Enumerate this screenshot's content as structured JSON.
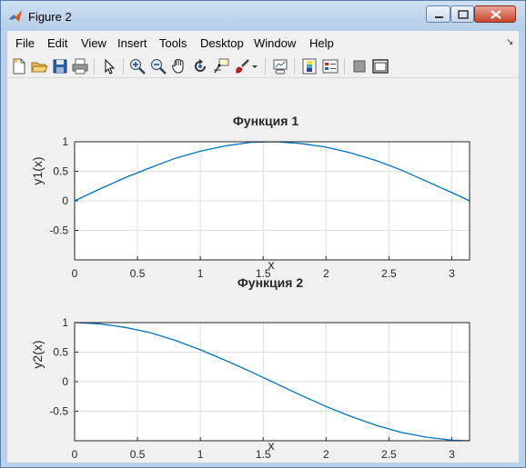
{
  "window": {
    "title": "Figure 2"
  },
  "menu": [
    "File",
    "Edit",
    "View",
    "Insert",
    "Tools",
    "Desktop",
    "Window",
    "Help"
  ],
  "toolbar_icons": [
    "new-figure-icon",
    "open-file-icon",
    "save-icon",
    "print-icon",
    "edit-plot-arrow-icon",
    "zoom-in-icon",
    "zoom-out-icon",
    "pan-hand-icon",
    "rotate-3d-icon",
    "data-cursor-icon",
    "brush-icon",
    "brush-dropdown-icon",
    "link-plot-icon",
    "insert-colorbar-icon",
    "insert-legend-icon",
    "hide-plot-tools-icon",
    "show-plot-tools-icon"
  ],
  "colors": {
    "line": "#0072bd",
    "grid": "#e0e0e0",
    "axes_bg": "#ffffff",
    "figure_bg": "#f0f0f0"
  },
  "chart_data": [
    {
      "type": "line",
      "title": "Функция 1",
      "xlabel": "x",
      "ylabel": "y1(x)",
      "xlim": [
        0,
        3.1416
      ],
      "ylim": [
        -1,
        1
      ],
      "xticks": [
        "0",
        "0.5",
        "1",
        "1.5",
        "2",
        "2.5",
        "3"
      ],
      "yticks": [
        "1",
        "0.5",
        "0",
        "-0.5"
      ],
      "grid": true,
      "series": [
        {
          "x": [
            0,
            0.2,
            0.4,
            0.6,
            0.8,
            1.0,
            1.2,
            1.4,
            1.6,
            1.8,
            2.0,
            2.2,
            2.4,
            2.6,
            2.8,
            3.0,
            3.1416
          ],
          "y": [
            0,
            0.2,
            0.39,
            0.56,
            0.72,
            0.84,
            0.93,
            0.99,
            1.0,
            0.97,
            0.91,
            0.81,
            0.68,
            0.52,
            0.33,
            0.14,
            0
          ]
        }
      ]
    },
    {
      "type": "line",
      "title": "Функция 2",
      "xlabel": "x",
      "ylabel": "y2(x)",
      "xlim": [
        0,
        3.1416
      ],
      "ylim": [
        -1,
        1
      ],
      "xticks": [
        "0",
        "0.5",
        "1",
        "1.5",
        "2",
        "2.5",
        "3"
      ],
      "yticks": [
        "1",
        "0.5",
        "0",
        "-0.5"
      ],
      "grid": true,
      "series": [
        {
          "x": [
            0,
            0.2,
            0.4,
            0.6,
            0.8,
            1.0,
            1.2,
            1.4,
            1.6,
            1.8,
            2.0,
            2.2,
            2.4,
            2.6,
            2.8,
            3.0,
            3.1416
          ],
          "y": [
            1,
            0.98,
            0.92,
            0.83,
            0.7,
            0.54,
            0.36,
            0.17,
            -0.03,
            -0.23,
            -0.42,
            -0.59,
            -0.74,
            -0.86,
            -0.94,
            -0.99,
            -1
          ]
        }
      ]
    }
  ]
}
